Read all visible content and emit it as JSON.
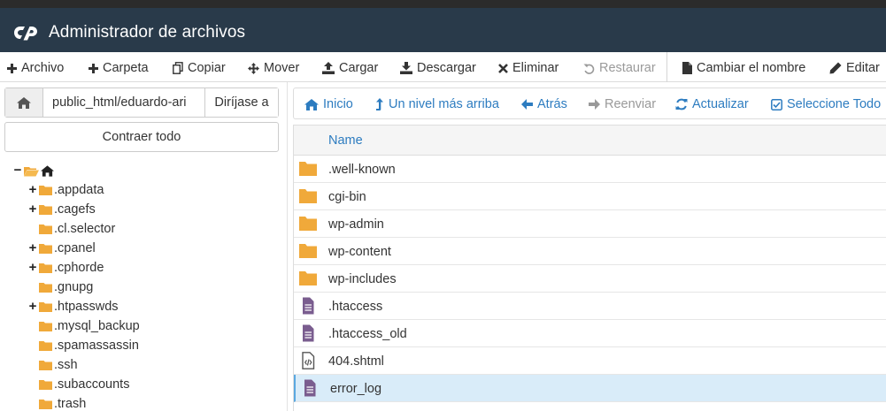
{
  "app": {
    "title": "Administrador de archivos",
    "brand_color": "#293a4a",
    "link_color": "#2d7cc0"
  },
  "toolbar": {
    "items": [
      {
        "label": "Archivo",
        "icon": "plus-icon",
        "enabled": true
      },
      {
        "label": "Carpeta",
        "icon": "plus-icon",
        "enabled": true
      },
      {
        "label": "Copiar",
        "icon": "copy-icon",
        "enabled": true
      },
      {
        "label": "Mover",
        "icon": "move-arrows-icon",
        "enabled": true
      },
      {
        "label": "Cargar",
        "icon": "upload-icon",
        "enabled": true
      },
      {
        "label": "Descargar",
        "icon": "download-icon",
        "enabled": true
      },
      {
        "label": "Eliminar",
        "icon": "x-icon",
        "enabled": true
      },
      {
        "label": "Restaurar",
        "icon": "undo-icon",
        "enabled": false
      },
      {
        "label": "Cambiar el nombre",
        "icon": "file-icon",
        "enabled": true
      },
      {
        "label": "Editar",
        "icon": "pencil-icon",
        "enabled": true
      }
    ]
  },
  "pathbar": {
    "value": "public_html/eduardo-ari",
    "go_label": "Diríjase a"
  },
  "sidebar": {
    "collapse_label": "Contraer todo",
    "root_label": "",
    "items": [
      {
        "label": ".appdata",
        "expandable": true
      },
      {
        "label": ".cagefs",
        "expandable": true
      },
      {
        "label": ".cl.selector",
        "expandable": false
      },
      {
        "label": ".cpanel",
        "expandable": true
      },
      {
        "label": ".cphorde",
        "expandable": true
      },
      {
        "label": ".gnupg",
        "expandable": false
      },
      {
        "label": ".htpasswds",
        "expandable": true
      },
      {
        "label": ".mysql_backup",
        "expandable": false
      },
      {
        "label": ".spamassassin",
        "expandable": false
      },
      {
        "label": ".ssh",
        "expandable": false
      },
      {
        "label": ".subaccounts",
        "expandable": false
      },
      {
        "label": ".trash",
        "expandable": false
      }
    ]
  },
  "nav": {
    "items": [
      {
        "label": "Inicio",
        "icon": "home-icon",
        "enabled": true
      },
      {
        "label": "Un nivel más arriba",
        "icon": "level-up-icon",
        "enabled": true
      },
      {
        "label": "Atrás",
        "icon": "arrow-left-icon",
        "enabled": true
      },
      {
        "label": "Reenviar",
        "icon": "arrow-right-icon",
        "enabled": false
      },
      {
        "label": "Actualizar",
        "icon": "refresh-icon",
        "enabled": true
      },
      {
        "label": "Seleccione Todo",
        "icon": "check-square-icon",
        "enabled": true
      }
    ]
  },
  "filelist": {
    "column_name": "Name",
    "rows": [
      {
        "name": ".well-known",
        "type": "folder",
        "selected": false
      },
      {
        "name": "cgi-bin",
        "type": "folder",
        "selected": false
      },
      {
        "name": "wp-admin",
        "type": "folder",
        "selected": false
      },
      {
        "name": "wp-content",
        "type": "folder",
        "selected": false
      },
      {
        "name": "wp-includes",
        "type": "folder",
        "selected": false
      },
      {
        "name": ".htaccess",
        "type": "text",
        "selected": false
      },
      {
        "name": ".htaccess_old",
        "type": "text",
        "selected": false
      },
      {
        "name": "404.shtml",
        "type": "code",
        "selected": false
      },
      {
        "name": "error_log",
        "type": "text",
        "selected": true
      }
    ]
  }
}
